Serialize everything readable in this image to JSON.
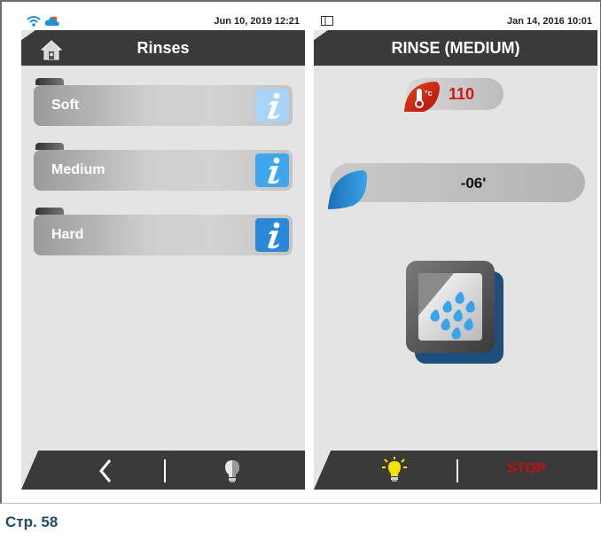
{
  "left_screen": {
    "status": {
      "datetime": "Jun 10, 2019 12:21",
      "icons": [
        "wifi-icon",
        "cloud-icon"
      ]
    },
    "title": "Rinses",
    "rinses": [
      {
        "label": "Soft",
        "info_color": "#a8d4f7"
      },
      {
        "label": "Medium",
        "info_color": "#3fa6ee"
      },
      {
        "label": "Hard",
        "info_color": "#2a88d8"
      }
    ],
    "bottom_bar": {
      "icons": [
        "back-chevron-icon",
        "lightbulb-off-icon"
      ]
    }
  },
  "right_screen": {
    "status": {
      "datetime": "Jan 14, 2016 10:01",
      "icons": [
        "panel-icon"
      ]
    },
    "title": "RINSE (MEDIUM)",
    "temperature": {
      "value": "110",
      "unit": "°C",
      "color": "#cc1a1a"
    },
    "time_remaining": "-06'",
    "program_icon": "rinse-water-drops-icon",
    "bottom_bar": {
      "stop_label": "STOP",
      "icons": [
        "lightbulb-on-icon"
      ]
    }
  },
  "page_caption": "Стр. 58",
  "colors": {
    "accent_blue": "#2a88d8",
    "bar_dark": "#3a3a3a",
    "stop_red": "#c01010"
  }
}
